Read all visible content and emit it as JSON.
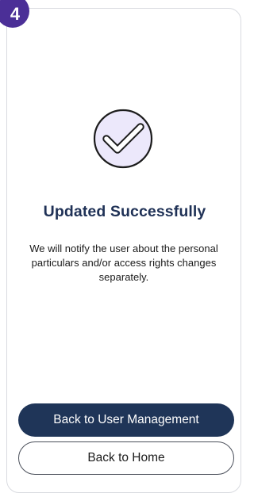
{
  "step": {
    "number": "4"
  },
  "result": {
    "icon": "check-circle-icon",
    "title": "Updated Successfully",
    "message": "We will notify the user about the personal particulars and/or access rights changes separately."
  },
  "actions": {
    "primary_label": "Back to User Management",
    "secondary_label": "Back to Home"
  },
  "colors": {
    "badge": "#4b2f97",
    "title": "#1f3156",
    "primary_button": "#1f3558",
    "icon_fill": "#ece8fb"
  }
}
